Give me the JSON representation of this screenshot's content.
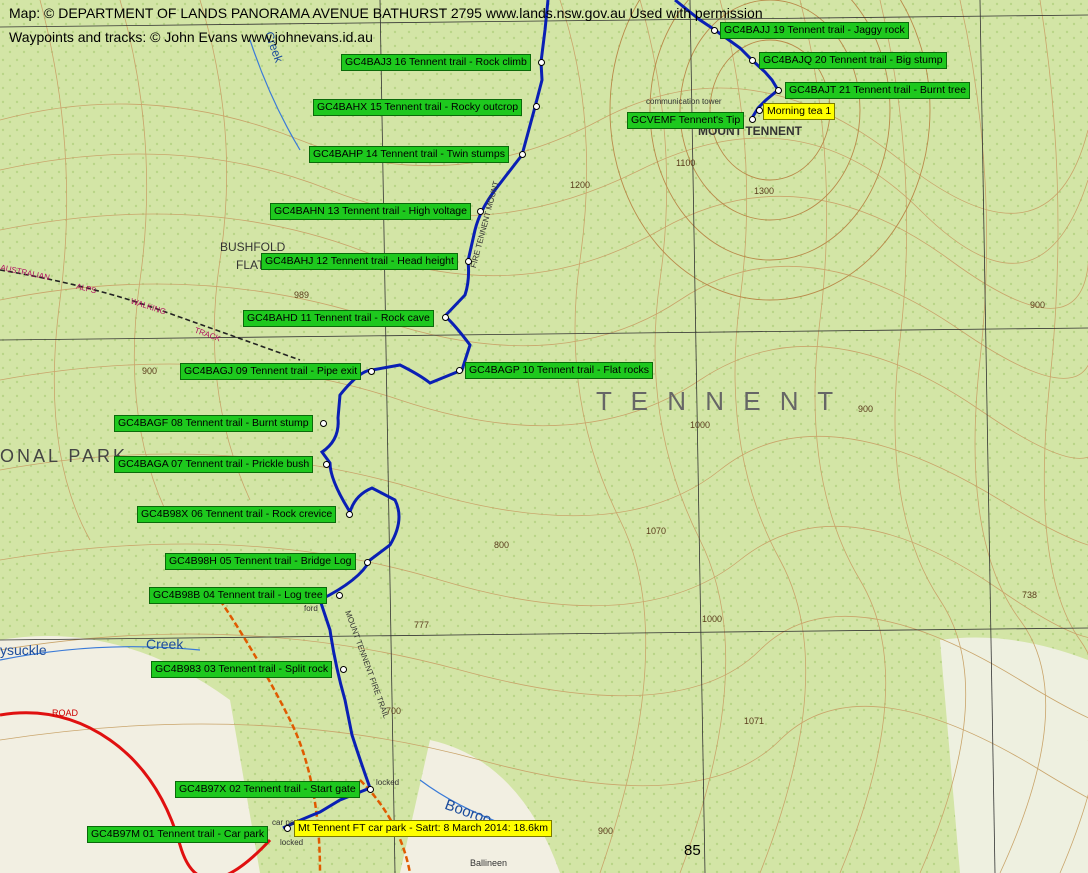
{
  "credits": {
    "line1": "Map: © DEPARTMENT OF LANDS PANORAMA AVENUE BATHURST 2795 www.lands.nsw.gov.au Used with permission",
    "line2": "Waypoints and tracks: © John Evans www.johnevans.id.au"
  },
  "colors": {
    "track": "#0a1fb4",
    "waypoint_label": "#1ec81e",
    "highlight_label": "#ffff00",
    "road": "#e01010",
    "fire_trail": "#e05a00"
  },
  "place_names": {
    "mount_tennent": "MOUNT TENNENT",
    "tennent": "T E N N E N T",
    "bushfold": "BUSHFOLD",
    "flat": "FLAT",
    "national_park": "ONAL    PARK",
    "creek_top": "Creek",
    "creek_bottom": "Creek",
    "honeysuckle": "ysuckle",
    "booroomba": "Booroo",
    "ballineen": "Ballineen",
    "grid_85": "85",
    "communication_tower": "communication tower",
    "car_park": "car park",
    "locked_top": "locked",
    "locked_bottom": "locked",
    "road": "ROAD",
    "walking_track_1": "AUSTRALIAN",
    "walking_track_2": "ALPS",
    "walking_track_3": "WALKING",
    "walking_track_4": "TRACK",
    "fire_trail_top": "FIRE TENNENT MOUNT",
    "fire_trail_bottom": "MOUNT TENNENT FIRE TRAIL",
    "ford": "ford"
  },
  "contour_numbers": [
    "1300",
    "1200",
    "900",
    "989",
    "900",
    "1000",
    "1070",
    "900",
    "1000",
    "777",
    "700",
    "800",
    "1071",
    "738",
    "900",
    "1100"
  ],
  "waypoints": [
    {
      "label": "GC4B97M 01 Tennent trail - Car park",
      "style": "green"
    },
    {
      "label": "GC4B97X 02 Tennent trail - Start gate",
      "style": "green"
    },
    {
      "label": "GC4B983 03 Tennent trail - Split rock",
      "style": "green"
    },
    {
      "label": "GC4B98B 04 Tennent trail - Log tree",
      "style": "green"
    },
    {
      "label": "GC4B98H 05 Tennent trail - Bridge Log",
      "style": "green"
    },
    {
      "label": "GC4B98X 06 Tennent trail - Rock crevice",
      "style": "green"
    },
    {
      "label": "GC4BAGA 07 Tennent trail - Prickle bush",
      "style": "green"
    },
    {
      "label": "GC4BAGF 08 Tennent trail - Burnt stump",
      "style": "green"
    },
    {
      "label": "GC4BAGJ 09 Tennent trail - Pipe exit",
      "style": "green"
    },
    {
      "label": "GC4BAGP 10 Tennent trail - Flat rocks",
      "style": "green"
    },
    {
      "label": "GC4BAHD 11 Tennent trail - Rock cave",
      "style": "green"
    },
    {
      "label": "GC4BAHJ 12 Tennent trail - Head height",
      "style": "green"
    },
    {
      "label": "GC4BAHN 13 Tennent trail - High voltage",
      "style": "green"
    },
    {
      "label": "GC4BAHP 14 Tennent trail - Twin stumps",
      "style": "green"
    },
    {
      "label": "GC4BAHX 15 Tennent trail - Rocky outcrop",
      "style": "green"
    },
    {
      "label": "GC4BAJ3 16 Tennent trail - Rock climb",
      "style": "green"
    },
    {
      "label": "GC4BAJJ 19 Tennent trail - Jaggy rock",
      "style": "green"
    },
    {
      "label": "GC4BAJQ 20 Tennent trail - Big stump",
      "style": "green"
    },
    {
      "label": "GC4BAJT 21 Tennent trail - Burnt tree",
      "style": "green"
    },
    {
      "label": "GCVEMF Tennent's Tip",
      "style": "green"
    },
    {
      "label": "Morning tea 1",
      "style": "yellow"
    },
    {
      "label": "Mt Tennent FT car park - Satrt: 8 March 2014: 18.6km",
      "style": "yellow"
    }
  ]
}
